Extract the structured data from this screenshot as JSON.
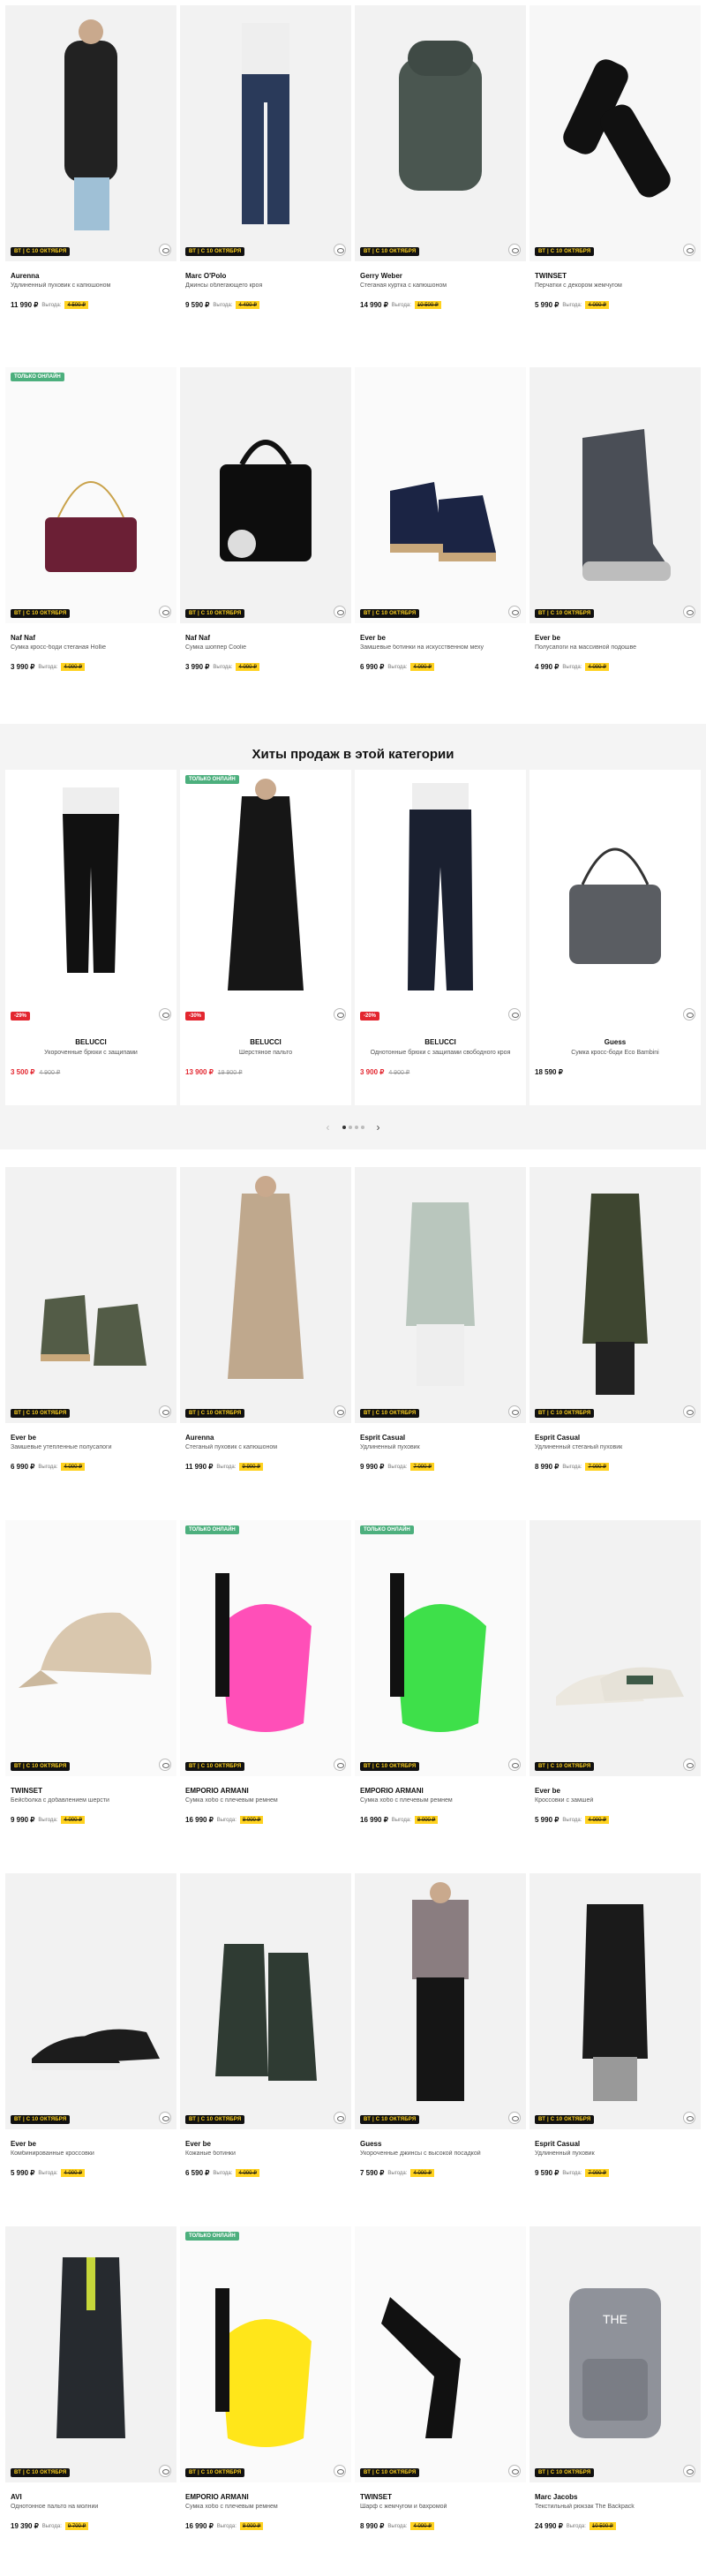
{
  "promo_label": "ВТ | С 10 ОКТЯБРЯ",
  "online_label": "ТОЛЬКО ОНЛАЙН",
  "vygoda_label": "Выгода:",
  "rows": [
    [
      {
        "brand": "Aurenna",
        "desc": "Удлиненный пуховик с капюшоном",
        "price": "11 990 ₽",
        "old": "4 500 ₽",
        "img": "coat-black",
        "online": false
      },
      {
        "brand": "Marc O'Polo",
        "desc": "Джинсы облегающего кроя",
        "price": "9 590 ₽",
        "old": "4 400 ₽",
        "img": "jeans",
        "online": false
      },
      {
        "brand": "Gerry Weber",
        "desc": "Стеганая куртка с капюшоном",
        "price": "14 990 ₽",
        "old": "10 500 ₽",
        "img": "jacket-green",
        "online": false
      },
      {
        "brand": "TWINSET",
        "desc": "Перчатки с декором жемчугом",
        "price": "5 990 ₽",
        "old": "4 000 ₽",
        "img": "gloves",
        "online": false
      }
    ],
    [
      {
        "brand": "Naf Naf",
        "desc": "Сумка кросс-боди стеганая Hollie",
        "price": "3 990 ₽",
        "old": "4 000 ₽",
        "img": "bag-wine",
        "online": true
      },
      {
        "brand": "Naf Naf",
        "desc": "Сумка шоппер Coolie",
        "price": "3 990 ₽",
        "old": "4 000 ₽",
        "img": "bag-black",
        "online": false
      },
      {
        "brand": "Ever be",
        "desc": "Замшевые ботинки на искусственном меху",
        "price": "6 990 ₽",
        "old": "4 000 ₽",
        "img": "boots-navy",
        "online": false
      },
      {
        "brand": "Ever be",
        "desc": "Полусапоги на массивной подошве",
        "price": "4 990 ₽",
        "old": "4 000 ₽",
        "img": "boots-grey",
        "online": false
      }
    ]
  ],
  "hits": {
    "title": "Хиты продаж в этой категории",
    "items": [
      {
        "brand": "BELUCCI",
        "desc": "Укороченные брюки с защипами",
        "price": "3 500 ₽",
        "old": "4 900 ₽",
        "disc": "-29%",
        "img": "trousers-black",
        "online": false
      },
      {
        "brand": "BELUCCI",
        "desc": "Шерстяное пальто",
        "price": "13 900 ₽",
        "old": "19 900 ₽",
        "disc": "-30%",
        "img": "coat-long-black",
        "online": true
      },
      {
        "brand": "BELUCCI",
        "desc": "Однотонные брюки с защипами свободного кроя",
        "price": "3 900 ₽",
        "old": "4 900 ₽",
        "disc": "-20%",
        "img": "trousers-navy",
        "online": false
      },
      {
        "brand": "Guess",
        "desc": "Сумка кросс-боди Eco Bambini",
        "price": "18 590 ₽",
        "old": "",
        "disc": "",
        "img": "bag-guess",
        "online": false
      }
    ],
    "prev": "‹",
    "next": "›"
  },
  "rows2": [
    [
      {
        "brand": "Ever be",
        "desc": "Замшевые утепленные полусапоги",
        "price": "6 990 ₽",
        "old": "4 000 ₽",
        "img": "boots-olive",
        "online": false
      },
      {
        "brand": "Aurenna",
        "desc": "Стеганый пуховик с капюшоном",
        "price": "11 990 ₽",
        "old": "9 900 ₽",
        "img": "coat-beige",
        "online": false
      },
      {
        "brand": "Esprit Casual",
        "desc": "Удлиненный пуховик",
        "price": "9 990 ₽",
        "old": "7 000 ₽",
        "img": "coat-mint",
        "online": false
      },
      {
        "brand": "Esprit Casual",
        "desc": "Удлиненный стеганый пуховик",
        "price": "8 990 ₽",
        "old": "7 000 ₽",
        "img": "coat-khaki",
        "online": false
      }
    ],
    [
      {
        "brand": "TWINSET",
        "desc": "Бейсболка с добавлением шерсти",
        "price": "9 990 ₽",
        "old": "4 000 ₽",
        "img": "cap",
        "online": false
      },
      {
        "brand": "EMPORIO ARMANI",
        "desc": "Сумка хобо с плечевым ремнем",
        "price": "16 990 ₽",
        "old": "8 000 ₽",
        "img": "bag-pink",
        "online": true
      },
      {
        "brand": "EMPORIO ARMANI",
        "desc": "Сумка хобо с плечевым ремнем",
        "price": "16 990 ₽",
        "old": "8 000 ₽",
        "img": "bag-green",
        "online": true
      },
      {
        "brand": "Ever be",
        "desc": "Кроссовки с замшей",
        "price": "5 990 ₽",
        "old": "4 000 ₽",
        "img": "sneakers-white",
        "online": false
      }
    ],
    [
      {
        "brand": "Ever be",
        "desc": "Комбинированные кроссовки",
        "price": "5 990 ₽",
        "old": "4 000 ₽",
        "img": "sneakers-black",
        "online": false
      },
      {
        "brand": "Ever be",
        "desc": "Кожаные ботинки",
        "price": "6 590 ₽",
        "old": "4 000 ₽",
        "img": "boots-dgreen",
        "online": false
      },
      {
        "brand": "Guess",
        "desc": "Укороченные джинсы с высокой посадкой",
        "price": "7 590 ₽",
        "old": "4 000 ₽",
        "img": "outfit-jeans",
        "online": false
      },
      {
        "brand": "Esprit Casual",
        "desc": "Удлиненный пуховик",
        "price": "9 590 ₽",
        "old": "7 000 ₽",
        "img": "coat-black2",
        "online": false
      }
    ],
    [
      {
        "brand": "AVI",
        "desc": "Однотонное пальто на молнии",
        "price": "19 390 ₽",
        "old": "9 700 ₽",
        "img": "coat-long2",
        "online": false
      },
      {
        "brand": "EMPORIO ARMANI",
        "desc": "Сумка хобо с плечевым ремнем",
        "price": "16 990 ₽",
        "old": "8 000 ₽",
        "img": "bag-yellow",
        "online": true
      },
      {
        "brand": "TWINSET",
        "desc": "Шарф с жемчугом и бахромой",
        "price": "8 990 ₽",
        "old": "4 000 ₽",
        "img": "scarf",
        "online": false
      },
      {
        "brand": "Marc Jacobs",
        "desc": "Текстильный рюкзак The Backpack",
        "price": "24 990 ₽",
        "old": "10 500 ₽",
        "img": "backpack",
        "online": false
      }
    ]
  ]
}
